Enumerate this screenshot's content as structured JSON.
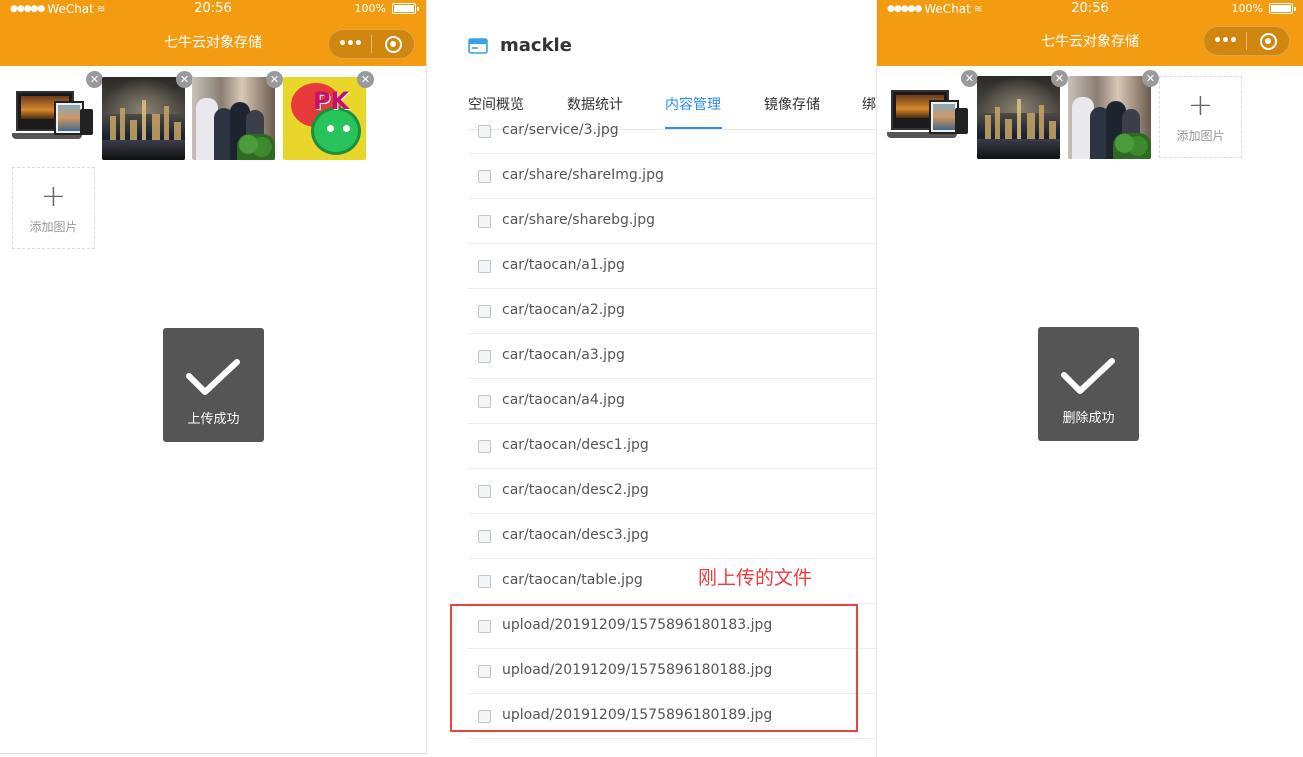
{
  "status": {
    "carrier": "WeChat",
    "time": "20:56",
    "battery": "100%"
  },
  "left_phone": {
    "title": "七牛云对象存储",
    "add_label": "添加图片",
    "toast": "上传成功"
  },
  "right_phone": {
    "title": "七牛云对象存储",
    "add_label": "添加图片",
    "toast": "删除成功"
  },
  "console": {
    "bucket_name": "mackle",
    "tabs": [
      "空间概览",
      "数据统计",
      "内容管理",
      "镜像存储",
      "绑"
    ],
    "active_tab": 2,
    "files": [
      "car/service/3.jpg",
      "car/share/shareImg.jpg",
      "car/share/sharebg.jpg",
      "car/taocan/a1.jpg",
      "car/taocan/a2.jpg",
      "car/taocan/a3.jpg",
      "car/taocan/a4.jpg",
      "car/taocan/desc1.jpg",
      "car/taocan/desc2.jpg",
      "car/taocan/desc3.jpg",
      "car/taocan/table.jpg",
      "upload/20191209/1575896180183.jpg",
      "upload/20191209/1575896180188.jpg",
      "upload/20191209/1575896180189.jpg"
    ],
    "callout": "刚上传的文件"
  },
  "colors": {
    "brand_orange": "#f39c12",
    "active_blue": "#2c8eef",
    "highlight_red": "#e8473f"
  }
}
